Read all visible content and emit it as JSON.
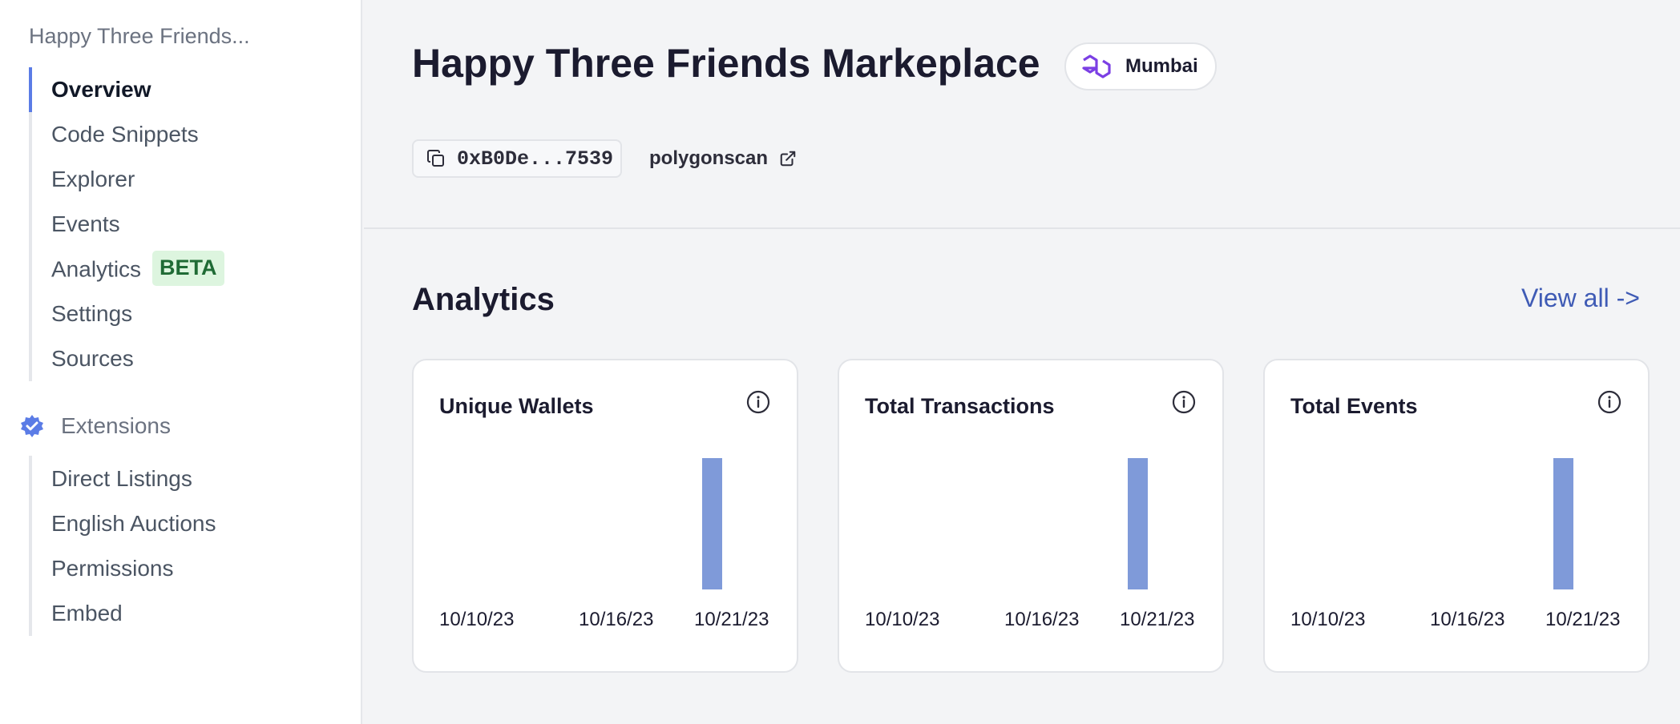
{
  "sidebar": {
    "contract_name": "Happy Three Friends...",
    "nav": [
      {
        "label": "Overview"
      },
      {
        "label": "Code Snippets"
      },
      {
        "label": "Explorer"
      },
      {
        "label": "Events"
      },
      {
        "label": "Analytics",
        "badge": "BETA"
      },
      {
        "label": "Settings"
      },
      {
        "label": "Sources"
      }
    ],
    "extensions_label": "Extensions",
    "extensions": [
      {
        "label": "Direct Listings"
      },
      {
        "label": "English Auctions"
      },
      {
        "label": "Permissions"
      },
      {
        "label": "Embed"
      }
    ]
  },
  "header": {
    "title": "Happy Three Friends Markeplace",
    "chain": "Mumbai",
    "address": "0xB0De...7539",
    "explorer_link": "polygonscan"
  },
  "analytics": {
    "title": "Analytics",
    "view_all": "View all ->",
    "cards": [
      {
        "title": "Unique Wallets",
        "icon": "info-icon",
        "chart_data": {
          "type": "bar",
          "x_ticks": [
            "10/10/23",
            "10/16/23",
            "10/21/23"
          ]
        }
      },
      {
        "title": "Total Transactions",
        "icon": "info-icon",
        "chart_data": {
          "type": "bar",
          "x_ticks": [
            "10/10/23",
            "10/16/23",
            "10/21/23"
          ]
        }
      },
      {
        "title": "Total Events",
        "icon": "info-icon",
        "chart_data": {
          "type": "bar",
          "x_ticks": [
            "10/10/23",
            "10/16/23",
            "10/21/23"
          ]
        }
      }
    ]
  },
  "colors": {
    "accent": "#5b7ce6",
    "bar": "#7f9ad9",
    "link": "#3f5bb5",
    "beta_bg": "#ddf5df",
    "polygon": "#7b3fe4"
  }
}
